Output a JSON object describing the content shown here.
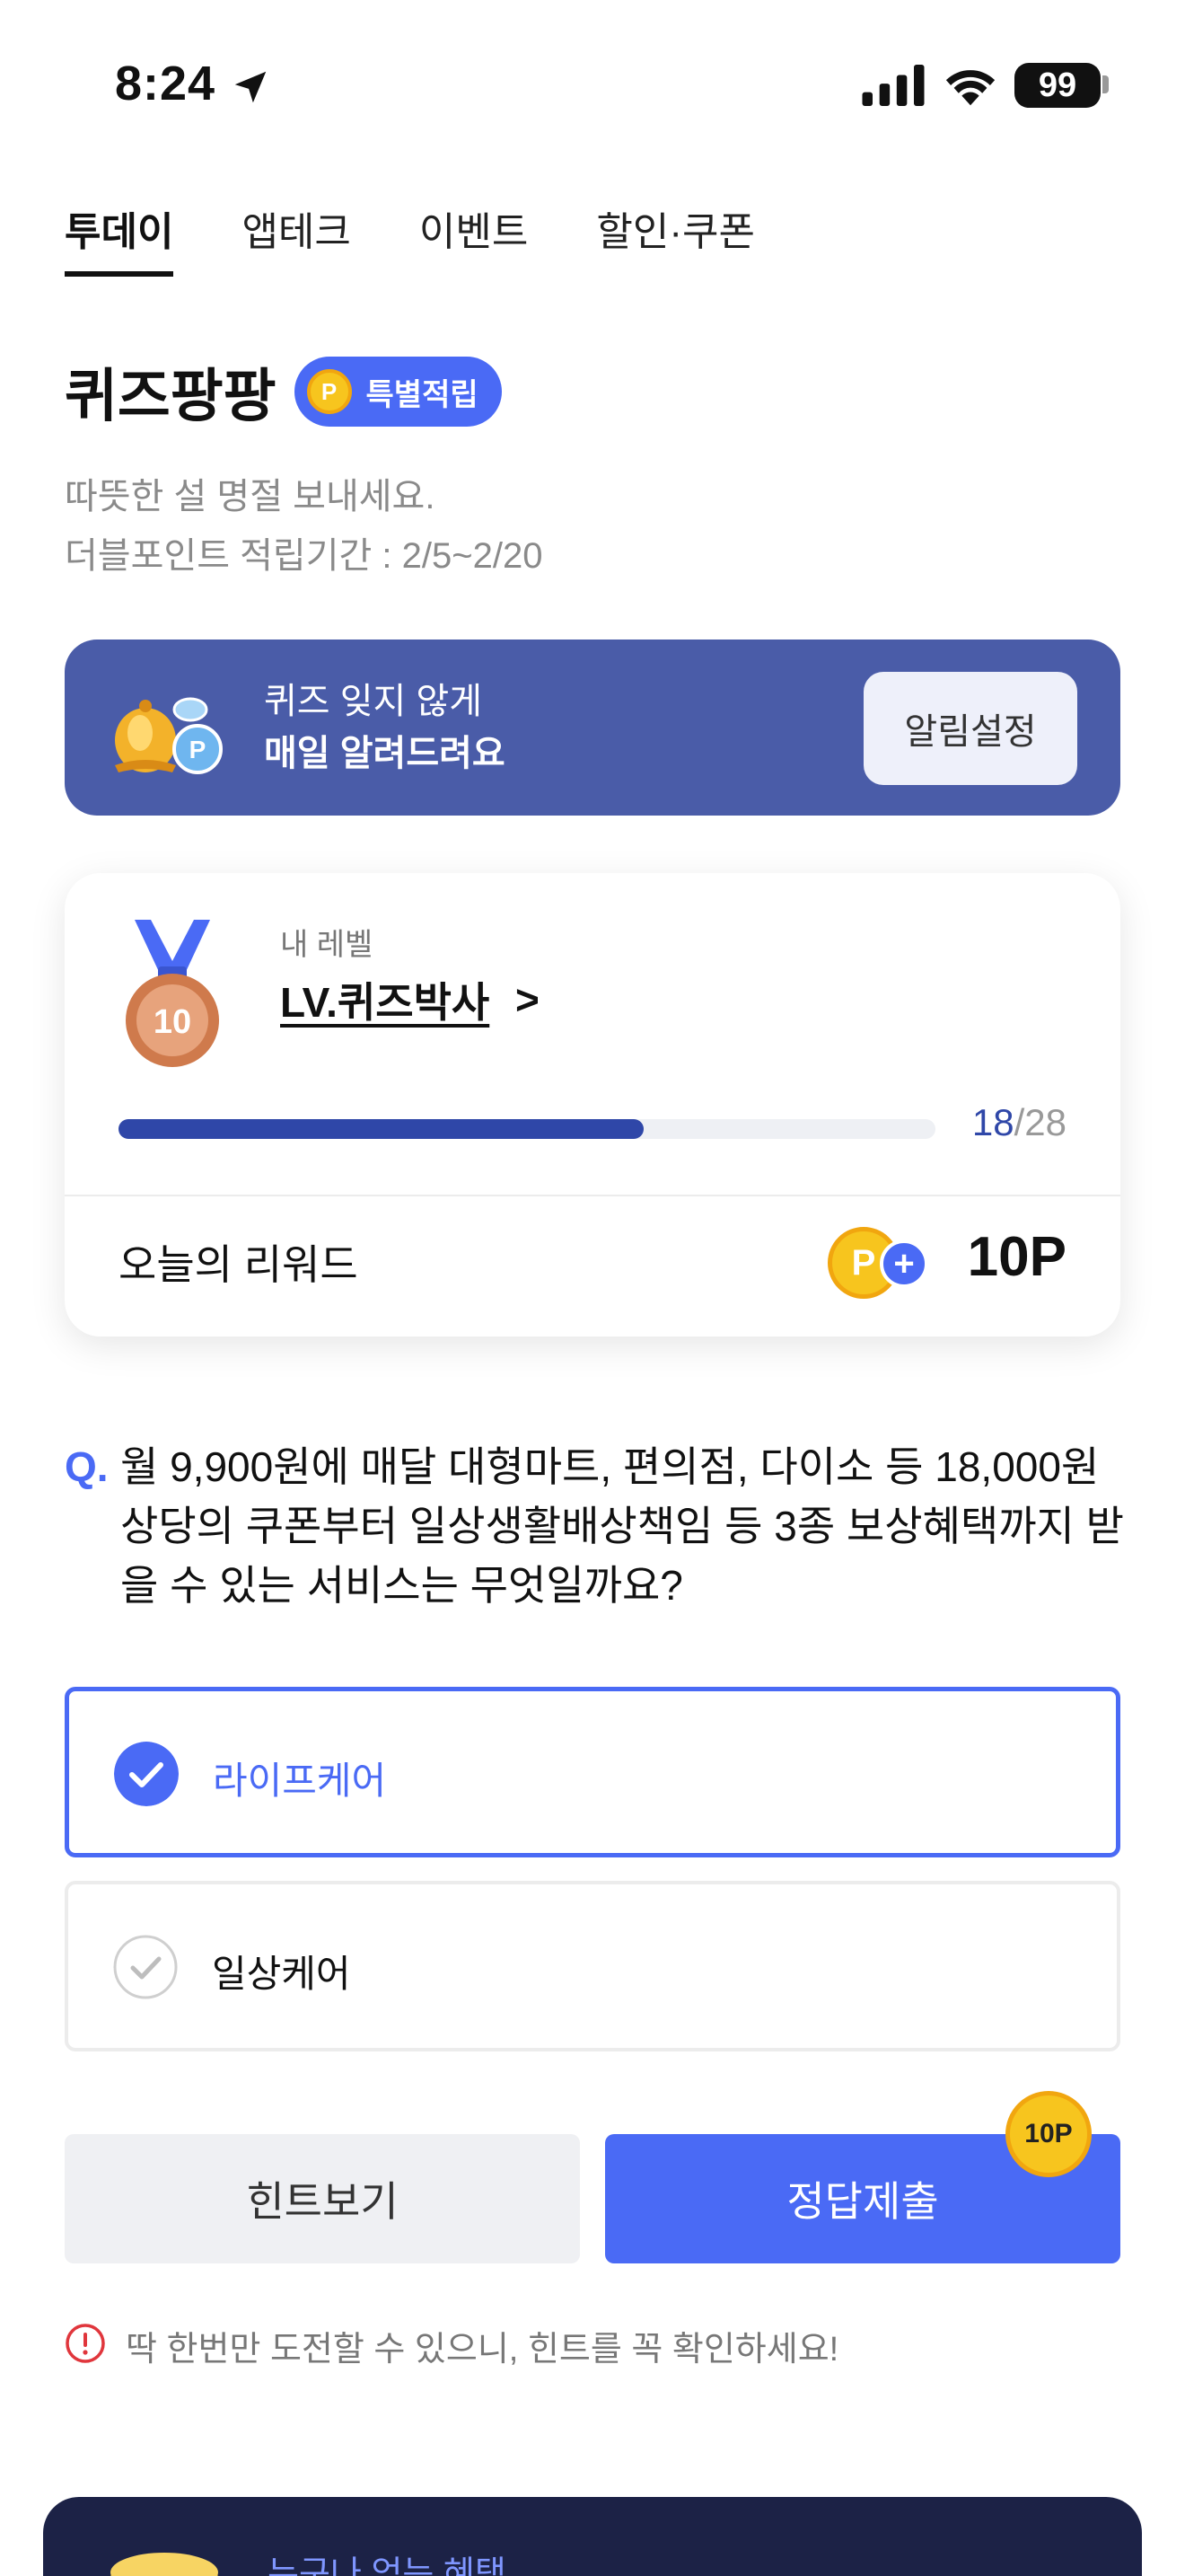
{
  "status_bar": {
    "time": "8:24",
    "battery": "99",
    "icons": [
      "location-arrow-icon",
      "signal-icon",
      "wifi-icon",
      "battery-icon"
    ]
  },
  "tabs": [
    {
      "label": "투데이",
      "active": true
    },
    {
      "label": "앱테크",
      "active": false
    },
    {
      "label": "이벤트",
      "active": false
    },
    {
      "label": "할인·쿠폰",
      "active": false
    }
  ],
  "header": {
    "title": "퀴즈팡팡",
    "badge": "특별적립",
    "badge_coin": "P",
    "subtitle_line1": "따뜻한 설 명절 보내세요.",
    "subtitle_line2": "더블포인트 적립기간 : 2/5~2/20"
  },
  "alarm": {
    "line1": "퀴즈 잊지 않게",
    "line2": "매일 알려드려요",
    "button": "알림설정"
  },
  "level": {
    "label": "내 레벨",
    "name": "LV.퀴즈박사",
    "chevron": ">",
    "medal_number": "10",
    "progress_current": "18",
    "progress_total": "/28",
    "progress_fraction": 0.643,
    "reward_label": "오늘의 리워드",
    "reward_coin": "P",
    "reward_plus": "+",
    "reward_value": "10P"
  },
  "question": {
    "marker": "Q.",
    "text": "월 9,900원에 매달 대형마트, 편의점, 다이소 등 18,000원 상당의 쿠폰부터 일상생활배상책임 등 3종 보상혜택까지 받을 수 있는 서비스는 무엇일까요?"
  },
  "options": [
    {
      "label": "라이프케어",
      "selected": true
    },
    {
      "label": "일상케어",
      "selected": false
    }
  ],
  "actions": {
    "hint": "힌트보기",
    "submit": "정답제출",
    "points_badge": "10P"
  },
  "warning": "딱 한번만 도전할 수 있으니, 힌트를 꼭 확인하세요!",
  "bottom_banner": {
    "text": "누구나 얻는 혜택"
  },
  "colors": {
    "accent": "#4a6af5",
    "banner": "#4a5ca8",
    "progress": "#2f47a8",
    "coin": "#f7c51e",
    "dark_banner": "#1c2246"
  }
}
